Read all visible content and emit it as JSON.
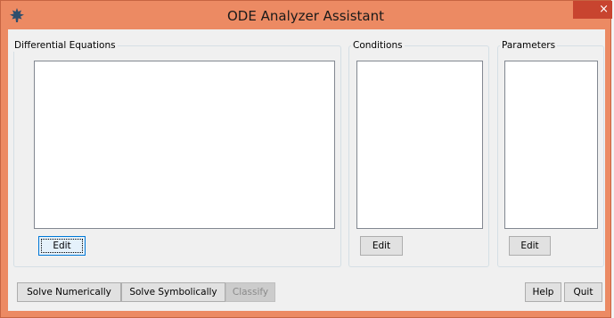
{
  "window": {
    "title": "ODE Analyzer Assistant",
    "close_glyph": "×",
    "icon": "maple-leaf-icon",
    "accent_color": "#ec8a63",
    "close_color": "#c8442f"
  },
  "panels": {
    "equations": {
      "label": "Differential Equations",
      "edit_label": "Edit"
    },
    "conditions": {
      "label": "Conditions",
      "edit_label": "Edit"
    },
    "parameters": {
      "label": "Parameters",
      "edit_label": "Edit"
    }
  },
  "footer": {
    "solve_numerically": "Solve Numerically",
    "solve_symbolically": "Solve Symbolically",
    "classify": "Classify",
    "help": "Help",
    "quit": "Quit"
  }
}
